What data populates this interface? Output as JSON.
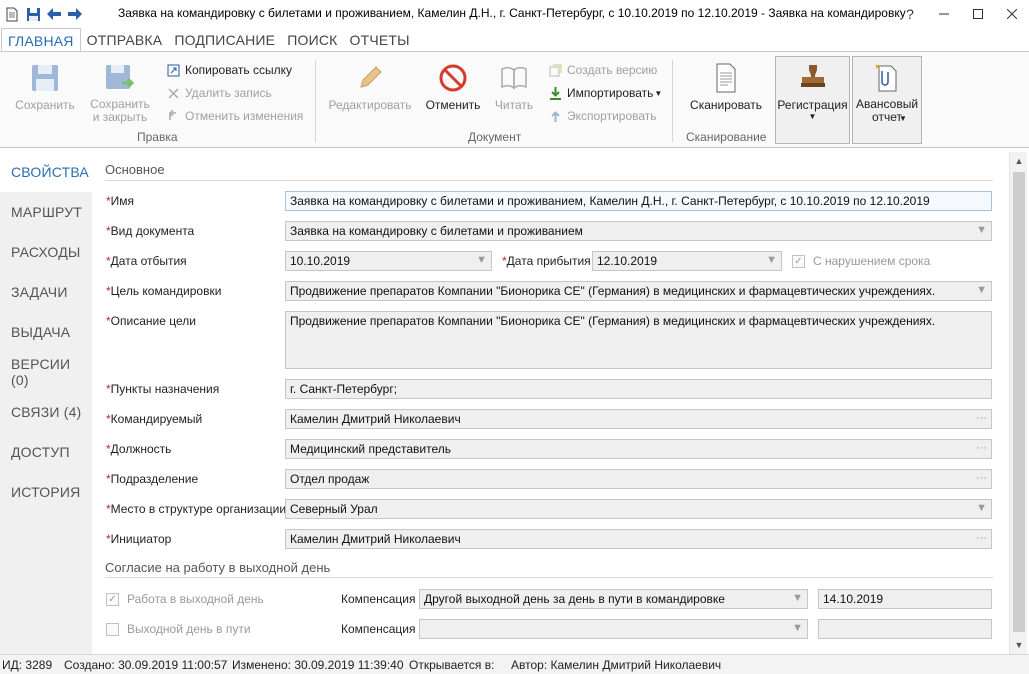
{
  "window": {
    "title": "Заявка на командировку с билетами и проживанием, Камелин Д.Н., г. Санкт-Петербург, с 10.10.2019 по 12.10.2019 - Заявка на командировку",
    "help": "?"
  },
  "tabs": [
    {
      "label": "ГЛАВНАЯ"
    },
    {
      "label": "ОТПРАВКА"
    },
    {
      "label": "ПОДПИСАНИЕ"
    },
    {
      "label": "ПОИСК"
    },
    {
      "label": "ОТЧЕТЫ"
    }
  ],
  "ribbon": {
    "save": "Сохранить",
    "save_close": "Сохранить\nи закрыть",
    "copy_link": "Копировать ссылку",
    "delete_record": "Удалить запись",
    "undo_changes": "Отменить изменения",
    "group_edit": "Правка",
    "edit": "Редактировать",
    "cancel": "Отменить",
    "read": "Читать",
    "create_version": "Создать версию",
    "import": "Импортировать",
    "export": "Экспортировать",
    "group_document": "Документ",
    "scan": "Сканировать",
    "group_scan": "Сканирование",
    "registration": "Регистрация",
    "advance_report": "Авансовый\nотчет"
  },
  "nav": [
    {
      "label": "СВОЙСТВА"
    },
    {
      "label": "МАРШРУТ"
    },
    {
      "label": "РАСХОДЫ"
    },
    {
      "label": "ЗАДАЧИ"
    },
    {
      "label": "ВЫДАЧА"
    },
    {
      "label": "ВЕРСИИ (0)"
    },
    {
      "label": "СВЯЗИ (4)"
    },
    {
      "label": "ДОСТУП"
    },
    {
      "label": "ИСТОРИЯ"
    }
  ],
  "form": {
    "section_main": "Основное",
    "required_mark": "*",
    "name_label": "Имя",
    "name_value": "Заявка на командировку с билетами и проживанием, Камелин Д.Н., г. Санкт-Петербург, с 10.10.2019 по 12.10.2019",
    "doctype_label": "Вид документа",
    "doctype_value": "Заявка на командировку с билетами и проживанием",
    "depart_label": "Дата отбытия",
    "depart_value": "10.10.2019",
    "arrive_label": "Дата прибытия",
    "arrive_value": "12.10.2019",
    "overdue_label": "С нарушением срока",
    "purpose_label": "Цель командировки",
    "purpose_value": "Продвижение препаратов Компании \"Бионорика СЕ\" (Германия) в медицинских и фармацевтических учреждениях.",
    "purpose_desc_label": "Описание цели",
    "purpose_desc_value": "Продвижение препаратов Компании \"Бионорика СЕ\" (Германия) в медицинских и фармацевтических учреждениях.",
    "dest_label": "Пункты назначения",
    "dest_value": "г. Санкт-Петербург;",
    "employee_label": "Командируемый",
    "employee_value": "Камелин Дмитрий Николаевич",
    "position_label": "Должность",
    "position_value": "Медицинский представитель",
    "dept_label": "Подразделение",
    "dept_value": "Отдел продаж",
    "org_label": "Место в структуре организации",
    "org_value": "Северный Урал",
    "initiator_label": "Инициатор",
    "initiator_value": "Камелин Дмитрий Николаевич",
    "ellipsis": "···",
    "section_weekend": "Согласие на работу в выходной день",
    "weekend_work_label": "Работа в выходной день",
    "weekend_travel_label": "Выходной день в пути",
    "comp_label1": "Компенсация",
    "comp_value1": "Другой выходной день за день в пути в командировке",
    "comp_date1": "14.10.2019",
    "comp_label2": "Компенсация",
    "comp_value2": "",
    "comp_date2": ""
  },
  "status": {
    "id": "ИД: 3289",
    "created": "Создано: 30.09.2019 11:00:57",
    "modified": "Изменено: 30.09.2019 11:39:40",
    "opens_in": "Открывается в:",
    "author": "Автор: Камелин Дмитрий Николаевич"
  }
}
